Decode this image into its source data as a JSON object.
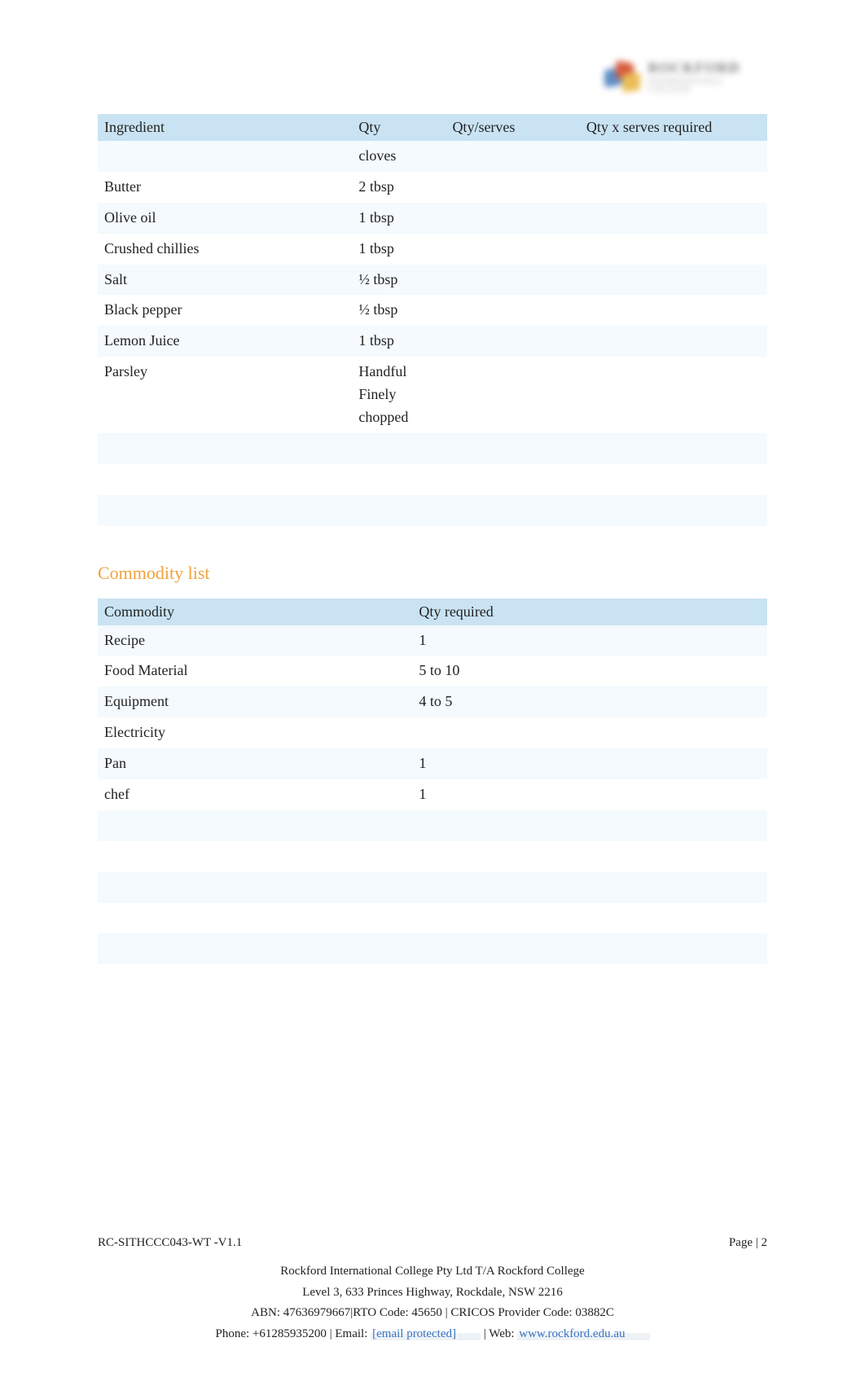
{
  "logo": {
    "name": "ROCKFORD",
    "sub": "INTERNATIONAL COLLEGE"
  },
  "ingredients": {
    "headers": {
      "ingredient": "Ingredient",
      "qty": "Qty",
      "qtyServes": "Qty/serves",
      "qtyReq": "Qty x serves required"
    },
    "rows": [
      {
        "ingredient": "",
        "qty": "cloves",
        "qtyServes": "",
        "qtyReq": ""
      },
      {
        "ingredient": "Butter",
        "qty": "2 tbsp",
        "qtyServes": "",
        "qtyReq": ""
      },
      {
        "ingredient": "Olive oil",
        "qty": "1 tbsp",
        "qtyServes": "",
        "qtyReq": ""
      },
      {
        "ingredient": "Crushed chillies",
        "qty": "1 tbsp",
        "qtyServes": "",
        "qtyReq": ""
      },
      {
        "ingredient": "Salt",
        "qty": "½ tbsp",
        "qtyServes": "",
        "qtyReq": ""
      },
      {
        "ingredient": "Black pepper",
        "qty": "½ tbsp",
        "qtyServes": "",
        "qtyReq": ""
      },
      {
        "ingredient": "Lemon Juice",
        "qty": "1 tbsp",
        "qtyServes": "",
        "qtyReq": ""
      },
      {
        "ingredient": "Parsley",
        "qty": "Handful Finely chopped",
        "qtyServes": "",
        "qtyReq": ""
      },
      {
        "ingredient": "",
        "qty": "",
        "qtyServes": "",
        "qtyReq": ""
      },
      {
        "ingredient": "",
        "qty": "",
        "qtyServes": "",
        "qtyReq": ""
      },
      {
        "ingredient": "",
        "qty": "",
        "qtyServes": "",
        "qtyReq": ""
      }
    ]
  },
  "sections": {
    "commodityTitle": "Commodity list"
  },
  "commodities": {
    "headers": {
      "commodity": "Commodity",
      "qtyRequired": "Qty required"
    },
    "rows": [
      {
        "commodity": "Recipe",
        "qty": "1"
      },
      {
        "commodity": "Food Material",
        "qty": "5 to 10"
      },
      {
        "commodity": "Equipment",
        "qty": "4 to 5"
      },
      {
        "commodity": "Electricity",
        "qty": ""
      },
      {
        "commodity": "Pan",
        "qty": "1"
      },
      {
        "commodity": "chef",
        "qty": "1"
      },
      {
        "commodity": "",
        "qty": ""
      },
      {
        "commodity": "",
        "qty": ""
      },
      {
        "commodity": "",
        "qty": ""
      },
      {
        "commodity": "",
        "qty": ""
      },
      {
        "commodity": "",
        "qty": ""
      },
      {
        "commodity": "",
        "qty": ""
      }
    ]
  },
  "footer": {
    "docCode": "RC-SITHCCC043-WT -V1.1",
    "pageLabel": "Page | 2",
    "line1": "Rockford International College Pty Ltd T/A Rockford College",
    "line2": "Level 3, 633 Princes Highway, Rockdale, NSW 2216",
    "line3": "ABN: 47636979667|RTO Code: 45650 | CRICOS Provider Code: 03882C",
    "phonePrefix": "Phone: +61285935200 | Email: ",
    "email": "[email protected]",
    "webPrefix": " | Web:  ",
    "web": "www.rockford.edu.au"
  }
}
